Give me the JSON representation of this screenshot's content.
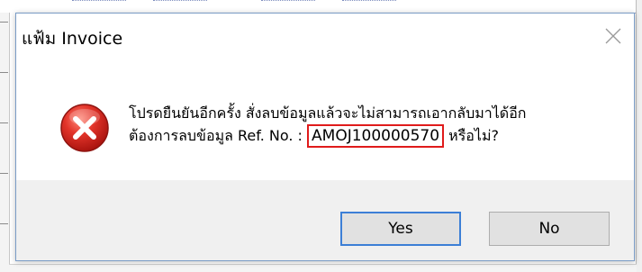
{
  "dialog": {
    "title": "แฟ้ม Invoice",
    "message_line1": "โปรดยืนยันอีกครั้ง สั่งลบข้อมูลแล้วจะไม่สามารถเอากลับมาได้อีก",
    "message_line2_prefix": "ต้องการลบข้อมูล Ref. No. : ",
    "ref_no": "AMOJ100000570",
    "message_line2_suffix": " หรือไม่?",
    "buttons": {
      "yes_label": "Yes",
      "no_label": "No"
    },
    "icons": {
      "status": "error-icon",
      "close": "close-icon"
    },
    "colors": {
      "error_red": "#d9231d",
      "highlight_box": "#e01b1b",
      "default_button_border": "#3c7fd6",
      "footer_bg": "#f0f0f0"
    }
  }
}
